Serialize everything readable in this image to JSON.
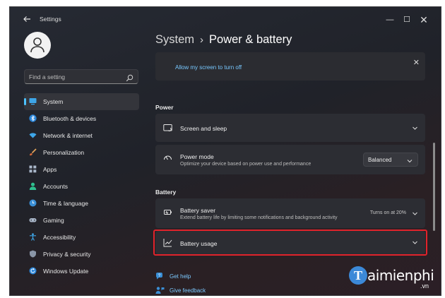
{
  "window": {
    "title": "Settings",
    "controls": {
      "minimize": "—",
      "maximize": "☐",
      "close": "✕"
    }
  },
  "search": {
    "placeholder": "Find a setting"
  },
  "sidebar": {
    "items": [
      {
        "label": "System",
        "icon": "display-icon",
        "active": true
      },
      {
        "label": "Bluetooth & devices",
        "icon": "bluetooth-icon"
      },
      {
        "label": "Network & internet",
        "icon": "wifi-icon"
      },
      {
        "label": "Personalization",
        "icon": "brush-icon"
      },
      {
        "label": "Apps",
        "icon": "apps-icon"
      },
      {
        "label": "Accounts",
        "icon": "person-icon"
      },
      {
        "label": "Time & language",
        "icon": "globe-clock-icon"
      },
      {
        "label": "Gaming",
        "icon": "gamepad-icon"
      },
      {
        "label": "Accessibility",
        "icon": "accessibility-icon"
      },
      {
        "label": "Privacy & security",
        "icon": "shield-icon"
      },
      {
        "label": "Windows Update",
        "icon": "update-icon"
      }
    ]
  },
  "breadcrumb": {
    "parent": "System",
    "separator": "›",
    "current": "Power & battery"
  },
  "top_card": {
    "link": "Allow my screen to turn off"
  },
  "power": {
    "section": "Power",
    "screen_sleep": {
      "title": "Screen and sleep"
    },
    "power_mode": {
      "title": "Power mode",
      "description": "Optimize your device based on power use and performance",
      "value": "Balanced"
    }
  },
  "battery": {
    "section": "Battery",
    "saver": {
      "title": "Battery saver",
      "description": "Extend battery life by limiting some notifications and background activity",
      "status": "Turns on at 20%"
    },
    "usage": {
      "title": "Battery usage"
    }
  },
  "help": {
    "get_help": "Get help",
    "give_feedback": "Give feedback"
  },
  "watermark": {
    "letter": "T",
    "text": "aimienphi",
    "suffix": ".vn"
  },
  "colors": {
    "accent": "#4cc2ff",
    "link": "#78c8ff",
    "highlight": "#e0232b",
    "background": "#202229"
  }
}
